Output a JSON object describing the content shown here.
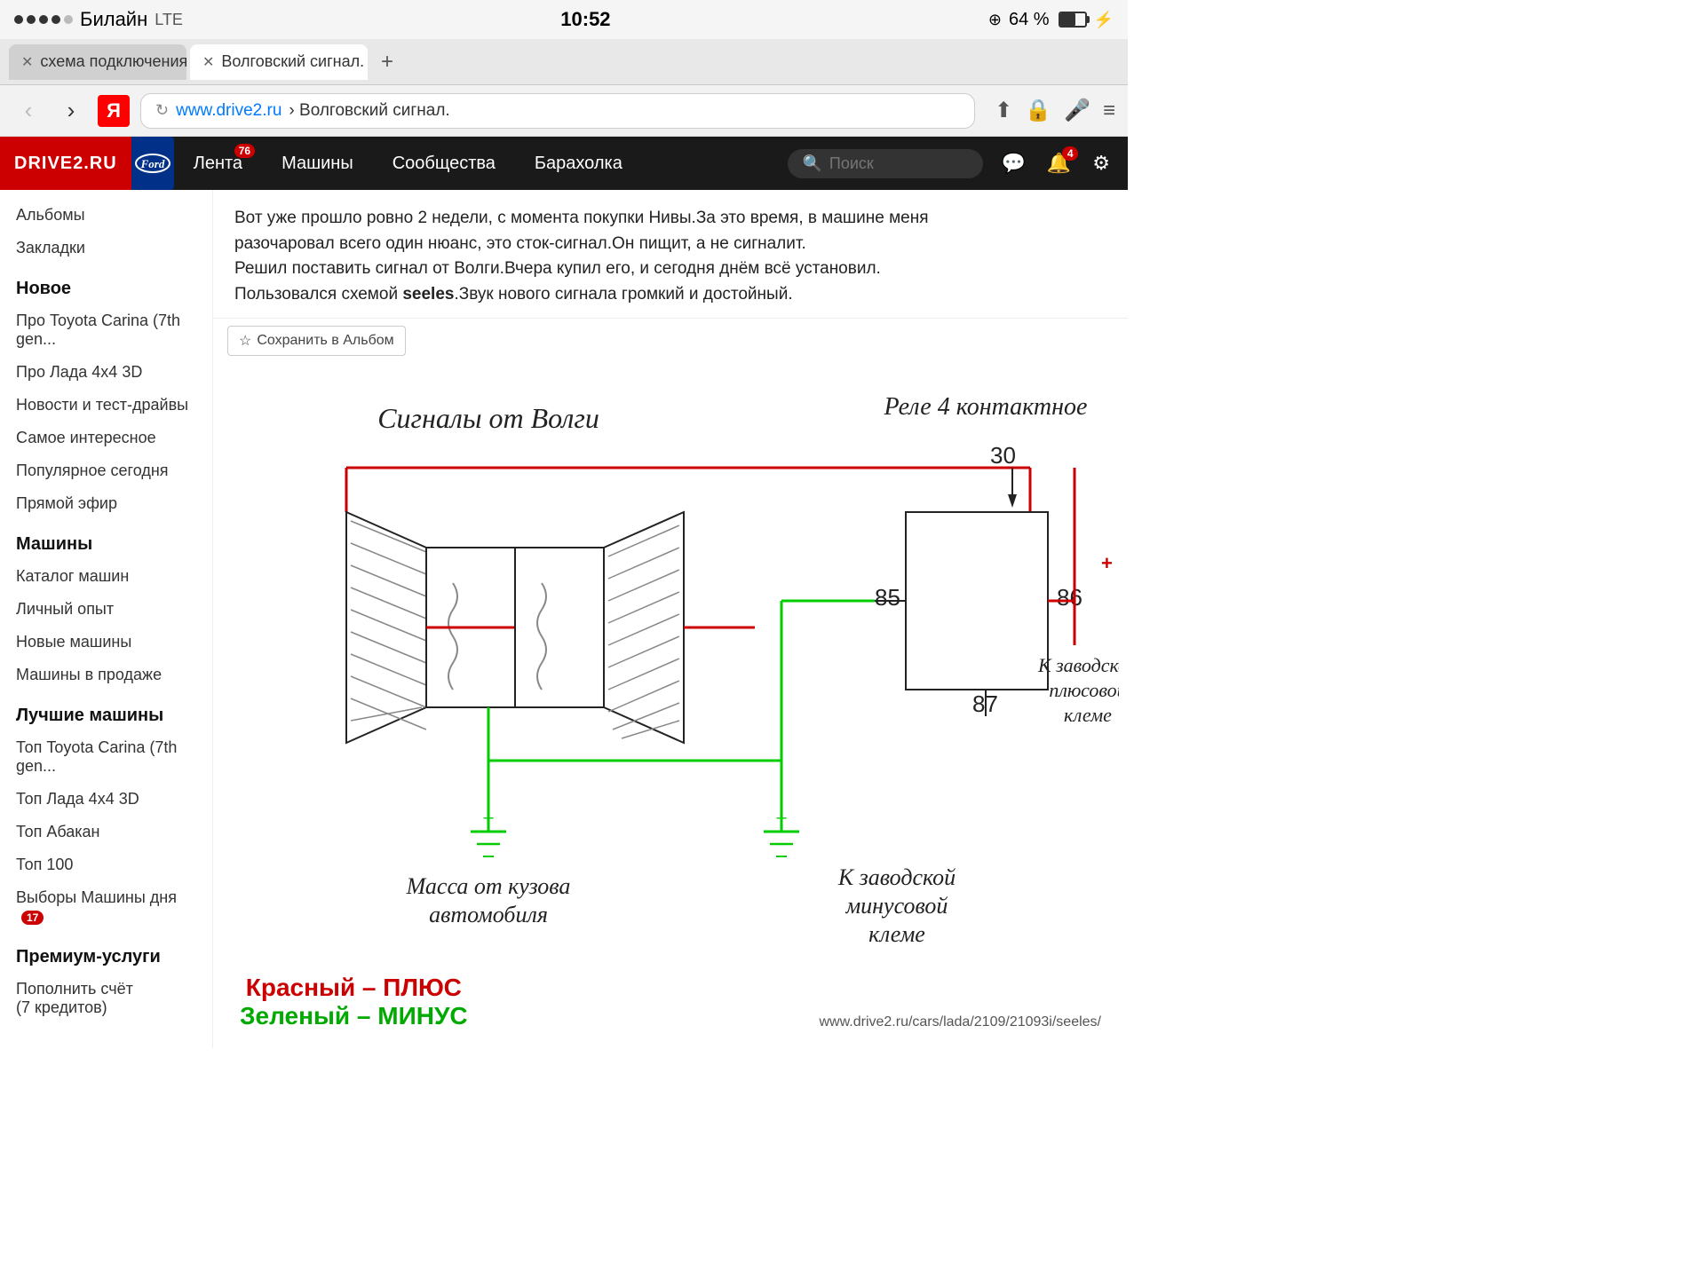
{
  "statusBar": {
    "carrier": "Билайн",
    "network": "LTE",
    "time": "10:52",
    "battery": "64 %",
    "location_icon": "●",
    "dots": 5
  },
  "tabs": [
    {
      "id": "tab1",
      "label": "схема подключения в...",
      "active": false
    },
    {
      "id": "tab2",
      "label": "Волговский сигнал.",
      "active": true
    }
  ],
  "tabAdd": "+",
  "urlBar": {
    "back": "‹",
    "forward": "›",
    "yandex": "Я",
    "reload": "↻",
    "url": "www.drive2.ru",
    "breadcrumb": "› Волговский сигнал.",
    "share_icon": "⬆",
    "lock_icon": "🔒",
    "mic_icon": "🎤",
    "menu_icon": "≡"
  },
  "nav": {
    "logo": "DRIVE2.RU",
    "ford_label": "Ford",
    "links": [
      {
        "label": "Лента",
        "badge": "76"
      },
      {
        "label": "Машины",
        "badge": null
      },
      {
        "label": "Сообщества",
        "badge": null
      },
      {
        "label": "Барахолка",
        "badge": null
      }
    ],
    "search_placeholder": "Поиск",
    "notifications_badge": "4"
  },
  "sidebar": {
    "top_items": [
      {
        "label": "Альбомы"
      },
      {
        "label": "Закладки"
      }
    ],
    "sections": [
      {
        "title": "Новое",
        "items": [
          {
            "label": "Про Toyota Carina (7th gen..."
          },
          {
            "label": "Про Лада 4x4 3D"
          },
          {
            "label": "Новости и тест-драйвы"
          },
          {
            "label": "Самое интересное"
          },
          {
            "label": "Популярное сегодня"
          },
          {
            "label": "Прямой эфир"
          }
        ]
      },
      {
        "title": "Машины",
        "items": [
          {
            "label": "Каталог машин"
          },
          {
            "label": "Личный опыт"
          },
          {
            "label": "Новые машины"
          },
          {
            "label": "Машины в продаже"
          }
        ]
      },
      {
        "title": "Лучшие машины",
        "items": [
          {
            "label": "Топ Toyota Carina (7th gen..."
          },
          {
            "label": "Топ Лада 4x4 3D"
          },
          {
            "label": "Топ Абакан"
          },
          {
            "label": "Топ 100"
          },
          {
            "label": "Выборы Машины дня",
            "badge": "17"
          }
        ]
      },
      {
        "title": "Премиум-услуги",
        "items": [
          {
            "label": "Пополнить счёт\n(7 кредитов)"
          }
        ]
      }
    ]
  },
  "article": {
    "text_lines": [
      "Вот уже прошло ровно 2 недели, с момента покупки Нивы.За это время, в машине меня",
      "разочаровал всего один нюанс, это сток-сигнал.Он пищит, а не сигналит.",
      "Решил поставить сигнал от Волги.Вчера купил его, и сегодня днём всё установил.",
      "Пользовался схемой seeles.Звук нового сигнала громкий и достойный."
    ],
    "bold_word": "seeles",
    "save_album": "Сохранить в Альбом"
  },
  "diagram": {
    "title_signals": "Сигналы от Волги",
    "title_relay": "Реле 4 контактное",
    "label_30": "30",
    "label_85": "85",
    "label_86": "86",
    "label_87": "87",
    "label_mass": "Масса от кузова\nавтомобиля",
    "label_plus": "К заводской\nплюсовой\nклеме",
    "label_minus": "К заводской\nминусовой\nклеме",
    "legend_red": "Красный – ПЛЮС",
    "legend_green": "Зеленый – МИНУС",
    "watermark": "www.drive2.ru/cars/lada/2109/21093i/seeles/"
  },
  "colors": {
    "red": "#cc0000",
    "green": "#00aa00",
    "diagram_red": "#cc0000",
    "diagram_green": "#00cc00",
    "diagram_black": "#222222"
  }
}
